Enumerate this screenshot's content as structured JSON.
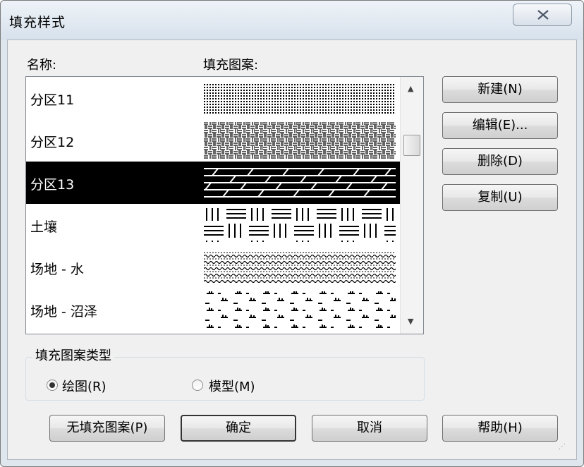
{
  "window": {
    "title": "填充样式"
  },
  "list": {
    "header_name": "名称:",
    "header_pattern": "填充图案:",
    "items": [
      {
        "name": "分区11",
        "pattern": "dense-dots",
        "selected": false
      },
      {
        "name": "分区12",
        "pattern": "basketweave",
        "selected": false
      },
      {
        "name": "分区13",
        "pattern": "diagonal-planks",
        "selected": true
      },
      {
        "name": "土壤",
        "pattern": "soil-bars",
        "selected": false
      },
      {
        "name": "场地 - 水",
        "pattern": "waves",
        "selected": false
      },
      {
        "name": "场地 - 沼泽",
        "pattern": "marsh-tufts",
        "selected": false
      }
    ]
  },
  "side_buttons": {
    "new": "新建(N)",
    "edit": "编辑(E)...",
    "delete": "删除(D)",
    "copy": "复制(U)"
  },
  "pattern_type": {
    "title": "填充图案类型",
    "options": [
      {
        "label": "绘图(R)",
        "checked": true
      },
      {
        "label": "模型(M)",
        "checked": false
      }
    ]
  },
  "bottom_buttons": {
    "no_pattern": "无填充图案(P)",
    "ok": "确定",
    "cancel": "取消",
    "help": "帮助(H)"
  },
  "icons": {
    "close": "close-icon",
    "scroll_up": "scroll-up-arrow-icon",
    "scroll_down": "scroll-down-arrow-icon",
    "resize_grip": "resize-grip-icon"
  },
  "colors": {
    "selection_bg": "#000000",
    "selection_text": "#ffffff"
  }
}
